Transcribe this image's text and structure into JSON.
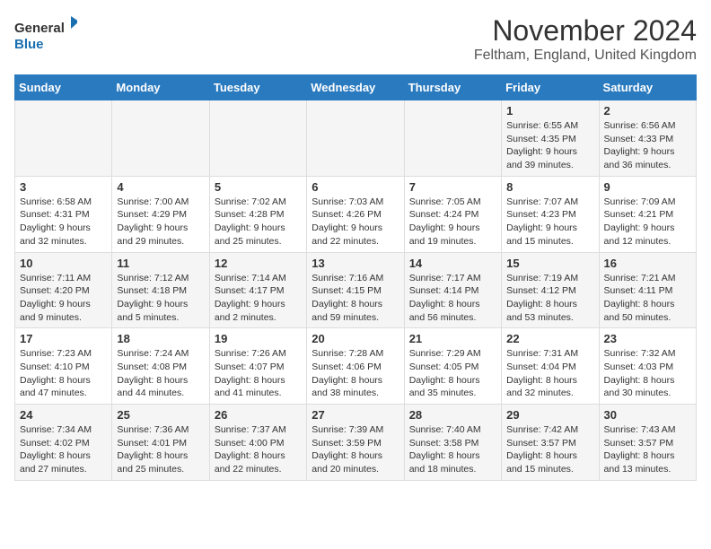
{
  "logo": {
    "general": "General",
    "blue": "Blue"
  },
  "title": "November 2024",
  "location": "Feltham, England, United Kingdom",
  "days_header": [
    "Sunday",
    "Monday",
    "Tuesday",
    "Wednesday",
    "Thursday",
    "Friday",
    "Saturday"
  ],
  "weeks": [
    [
      {
        "day": "",
        "info": ""
      },
      {
        "day": "",
        "info": ""
      },
      {
        "day": "",
        "info": ""
      },
      {
        "day": "",
        "info": ""
      },
      {
        "day": "",
        "info": ""
      },
      {
        "day": "1",
        "info": "Sunrise: 6:55 AM\nSunset: 4:35 PM\nDaylight: 9 hours and 39 minutes."
      },
      {
        "day": "2",
        "info": "Sunrise: 6:56 AM\nSunset: 4:33 PM\nDaylight: 9 hours and 36 minutes."
      }
    ],
    [
      {
        "day": "3",
        "info": "Sunrise: 6:58 AM\nSunset: 4:31 PM\nDaylight: 9 hours and 32 minutes."
      },
      {
        "day": "4",
        "info": "Sunrise: 7:00 AM\nSunset: 4:29 PM\nDaylight: 9 hours and 29 minutes."
      },
      {
        "day": "5",
        "info": "Sunrise: 7:02 AM\nSunset: 4:28 PM\nDaylight: 9 hours and 25 minutes."
      },
      {
        "day": "6",
        "info": "Sunrise: 7:03 AM\nSunset: 4:26 PM\nDaylight: 9 hours and 22 minutes."
      },
      {
        "day": "7",
        "info": "Sunrise: 7:05 AM\nSunset: 4:24 PM\nDaylight: 9 hours and 19 minutes."
      },
      {
        "day": "8",
        "info": "Sunrise: 7:07 AM\nSunset: 4:23 PM\nDaylight: 9 hours and 15 minutes."
      },
      {
        "day": "9",
        "info": "Sunrise: 7:09 AM\nSunset: 4:21 PM\nDaylight: 9 hours and 12 minutes."
      }
    ],
    [
      {
        "day": "10",
        "info": "Sunrise: 7:11 AM\nSunset: 4:20 PM\nDaylight: 9 hours and 9 minutes."
      },
      {
        "day": "11",
        "info": "Sunrise: 7:12 AM\nSunset: 4:18 PM\nDaylight: 9 hours and 5 minutes."
      },
      {
        "day": "12",
        "info": "Sunrise: 7:14 AM\nSunset: 4:17 PM\nDaylight: 9 hours and 2 minutes."
      },
      {
        "day": "13",
        "info": "Sunrise: 7:16 AM\nSunset: 4:15 PM\nDaylight: 8 hours and 59 minutes."
      },
      {
        "day": "14",
        "info": "Sunrise: 7:17 AM\nSunset: 4:14 PM\nDaylight: 8 hours and 56 minutes."
      },
      {
        "day": "15",
        "info": "Sunrise: 7:19 AM\nSunset: 4:12 PM\nDaylight: 8 hours and 53 minutes."
      },
      {
        "day": "16",
        "info": "Sunrise: 7:21 AM\nSunset: 4:11 PM\nDaylight: 8 hours and 50 minutes."
      }
    ],
    [
      {
        "day": "17",
        "info": "Sunrise: 7:23 AM\nSunset: 4:10 PM\nDaylight: 8 hours and 47 minutes."
      },
      {
        "day": "18",
        "info": "Sunrise: 7:24 AM\nSunset: 4:08 PM\nDaylight: 8 hours and 44 minutes."
      },
      {
        "day": "19",
        "info": "Sunrise: 7:26 AM\nSunset: 4:07 PM\nDaylight: 8 hours and 41 minutes."
      },
      {
        "day": "20",
        "info": "Sunrise: 7:28 AM\nSunset: 4:06 PM\nDaylight: 8 hours and 38 minutes."
      },
      {
        "day": "21",
        "info": "Sunrise: 7:29 AM\nSunset: 4:05 PM\nDaylight: 8 hours and 35 minutes."
      },
      {
        "day": "22",
        "info": "Sunrise: 7:31 AM\nSunset: 4:04 PM\nDaylight: 8 hours and 32 minutes."
      },
      {
        "day": "23",
        "info": "Sunrise: 7:32 AM\nSunset: 4:03 PM\nDaylight: 8 hours and 30 minutes."
      }
    ],
    [
      {
        "day": "24",
        "info": "Sunrise: 7:34 AM\nSunset: 4:02 PM\nDaylight: 8 hours and 27 minutes."
      },
      {
        "day": "25",
        "info": "Sunrise: 7:36 AM\nSunset: 4:01 PM\nDaylight: 8 hours and 25 minutes."
      },
      {
        "day": "26",
        "info": "Sunrise: 7:37 AM\nSunset: 4:00 PM\nDaylight: 8 hours and 22 minutes."
      },
      {
        "day": "27",
        "info": "Sunrise: 7:39 AM\nSunset: 3:59 PM\nDaylight: 8 hours and 20 minutes."
      },
      {
        "day": "28",
        "info": "Sunrise: 7:40 AM\nSunset: 3:58 PM\nDaylight: 8 hours and 18 minutes."
      },
      {
        "day": "29",
        "info": "Sunrise: 7:42 AM\nSunset: 3:57 PM\nDaylight: 8 hours and 15 minutes."
      },
      {
        "day": "30",
        "info": "Sunrise: 7:43 AM\nSunset: 3:57 PM\nDaylight: 8 hours and 13 minutes."
      }
    ]
  ]
}
